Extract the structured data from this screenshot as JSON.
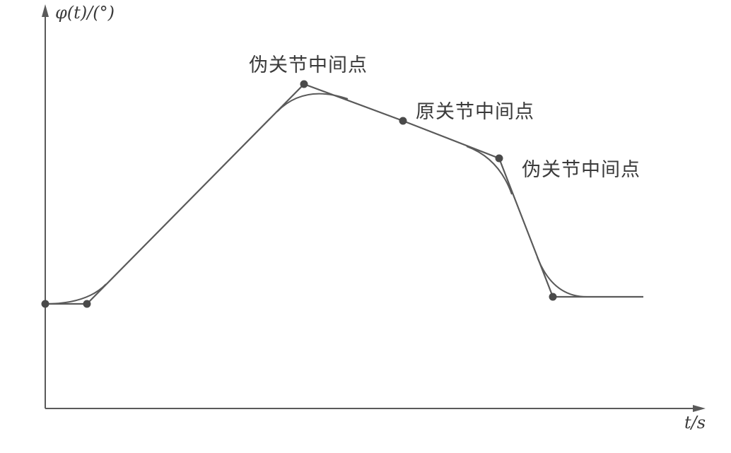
{
  "axes": {
    "y_label": "φ(t)/(°)",
    "x_label": "t/s"
  },
  "annotations": {
    "pseudo_via_point_top": "伪关节中间点",
    "original_via_point": "原关节中间点",
    "pseudo_via_point_right": "伪关节中间点"
  },
  "colors": {
    "line": "#5a5a5a",
    "point": "#4a4a4a",
    "text": "#3a3a3a"
  },
  "icons": [
    "arrow-up-icon",
    "arrow-right-icon"
  ]
}
